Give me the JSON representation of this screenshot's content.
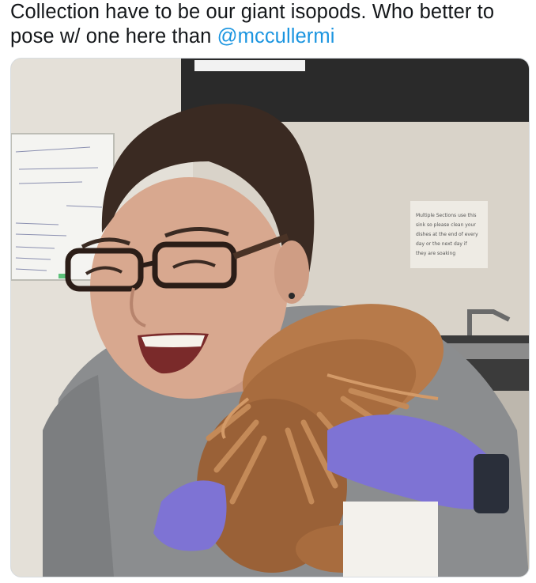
{
  "tweet": {
    "text_before_mention": "Collection have to be our giant isopods. Who better to pose w/ one here than ",
    "mention": "@mccullermi"
  },
  "photo": {
    "sign_lines": [
      "Multiple Sections use this",
      "sink so please clean your",
      "dishes at the end of every",
      "day or the next day if",
      "they are soaking"
    ]
  }
}
